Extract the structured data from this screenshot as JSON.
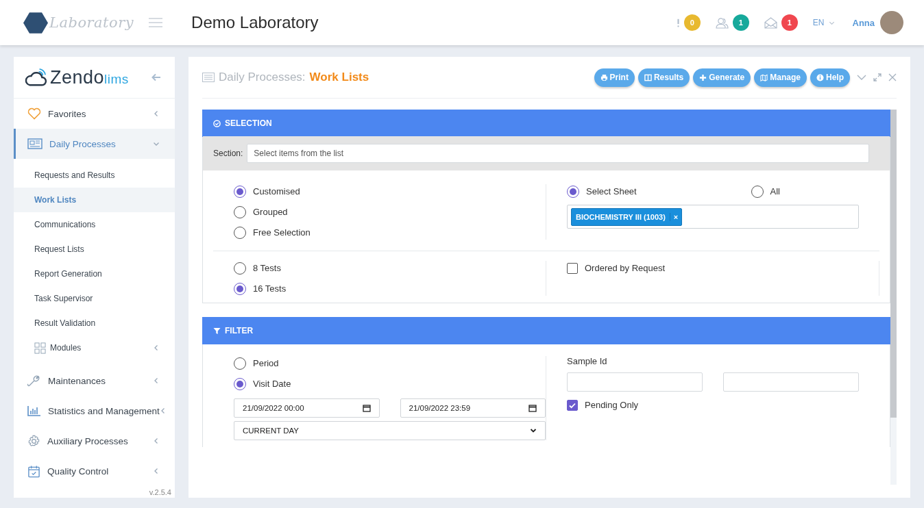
{
  "header": {
    "logo_text": "Laboratory",
    "title": "Demo Laboratory",
    "notifications": [
      {
        "kind": "alert",
        "count": "0",
        "color": "#e8b92f"
      },
      {
        "kind": "users",
        "count": "1",
        "color": "#17a99b"
      },
      {
        "kind": "mail",
        "count": "1",
        "color": "#f0474f"
      }
    ],
    "language": "EN",
    "user": "Anna"
  },
  "sidebar": {
    "brand": "Zendo",
    "brand_suffix": "lims",
    "items": [
      {
        "label": "Favorites",
        "selected": false,
        "expanded": false
      },
      {
        "label": "Daily Processes",
        "selected": true,
        "expanded": true,
        "children": [
          {
            "label": "Requests and Results",
            "selected": false
          },
          {
            "label": "Work Lists",
            "selected": true
          },
          {
            "label": "Communications",
            "selected": false
          },
          {
            "label": "Request Lists",
            "selected": false
          },
          {
            "label": "Report Generation",
            "selected": false
          },
          {
            "label": "Task Supervisor",
            "selected": false
          },
          {
            "label": "Result Validation",
            "selected": false
          },
          {
            "label": "Modules",
            "kind": "group",
            "selected": false,
            "expanded": false
          }
        ]
      },
      {
        "label": "Maintenances",
        "selected": false,
        "expanded": false
      },
      {
        "label": "Statistics and Management",
        "selected": false,
        "expanded": false
      },
      {
        "label": "Auxiliary Processes",
        "selected": false,
        "expanded": false
      },
      {
        "label": "Quality Control",
        "selected": false,
        "expanded": false
      }
    ],
    "version": "v.2.5.4"
  },
  "panel": {
    "breadcrumb": "Daily Processes:",
    "title": "Work Lists",
    "buttons": [
      {
        "label": "Print"
      },
      {
        "label": "Results"
      },
      {
        "label": "Generate"
      },
      {
        "label": "Manage"
      },
      {
        "label": "Help"
      }
    ],
    "selection": {
      "heading": "SELECTION",
      "section_label": "Section:",
      "section_placeholder": "Select items from the list",
      "modes": [
        {
          "label": "Customised",
          "selected": true
        },
        {
          "label": "Grouped",
          "selected": false
        },
        {
          "label": "Free Selection",
          "selected": false
        }
      ],
      "sheet_options": [
        {
          "label": "Select Sheet",
          "selected": true
        },
        {
          "label": "All",
          "selected": false
        }
      ],
      "sheet_tags": [
        {
          "label": "BIOCHEMISTRY III (1003)",
          "remove": "×"
        }
      ],
      "tests": [
        {
          "label": "8 Tests",
          "selected": false
        },
        {
          "label": "16 Tests",
          "selected": true
        }
      ],
      "ordered_by_request": {
        "label": "Ordered by Request",
        "checked": false
      }
    },
    "filter": {
      "heading": "FILTER",
      "date_modes": [
        {
          "label": "Period",
          "selected": false
        },
        {
          "label": "Visit Date",
          "selected": true
        }
      ],
      "date_from": "21/09/2022 00:00",
      "date_to": "21/09/2022 23:59",
      "range": "CURRENT DAY",
      "sample_id_label": "Sample Id",
      "pending_only": {
        "label": "Pending Only",
        "checked": true
      }
    }
  }
}
